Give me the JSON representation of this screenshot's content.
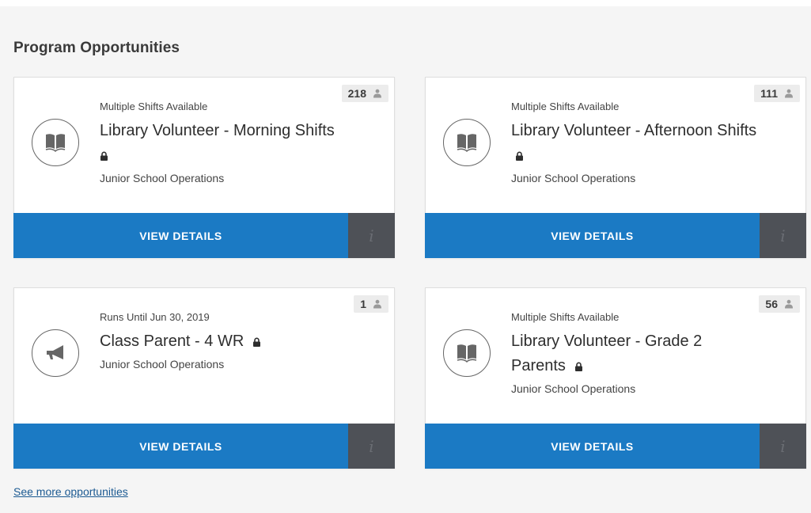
{
  "section": {
    "title": "Program Opportunities",
    "see_more": "See more opportunities"
  },
  "colors": {
    "primary_button": "#1b7ac4",
    "info_button": "#4e5157",
    "link": "#1c5a92"
  },
  "cards": [
    {
      "count": "218",
      "subline": "Multiple Shifts Available",
      "title": "Library Volunteer - Morning Shifts",
      "department": "Junior School Operations",
      "icon": "book-icon",
      "locked": true,
      "view_label": "VIEW DETAILS",
      "info_label": "i"
    },
    {
      "count": "111",
      "subline": "Multiple Shifts Available",
      "title": "Library Volunteer - Afternoon Shifts",
      "department": "Junior School Operations",
      "icon": "book-icon",
      "locked": true,
      "view_label": "VIEW DETAILS",
      "info_label": "i"
    },
    {
      "count": "1",
      "subline": "Runs Until Jun 30, 2019",
      "title": "Class Parent - 4 WR",
      "department": "Junior School Operations",
      "icon": "megaphone-icon",
      "locked": true,
      "view_label": "VIEW DETAILS",
      "info_label": "i"
    },
    {
      "count": "56",
      "subline": "Multiple Shifts Available",
      "title": "Library Volunteer - Grade 2 Parents",
      "department": "Junior School Operations",
      "icon": "book-icon",
      "locked": true,
      "view_label": "VIEW DETAILS",
      "info_label": "i"
    }
  ]
}
